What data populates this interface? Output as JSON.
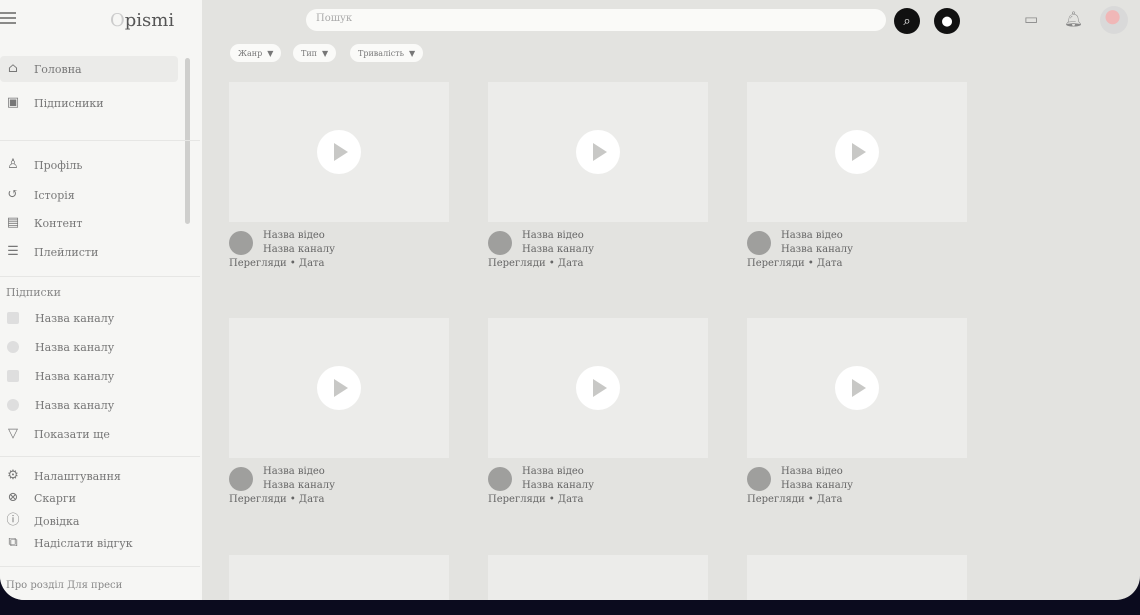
{
  "app": {
    "logo_text": "pismi",
    "logo_mark": "O"
  },
  "search": {
    "placeholder": "Пошук"
  },
  "sidebar": {
    "main_items": [
      {
        "label": "Головна",
        "icon": "home-icon"
      },
      {
        "label": "Підписники",
        "icon": "subscriptions-icon"
      }
    ],
    "profile_items": [
      {
        "label": "Профіль",
        "icon": "user-icon"
      },
      {
        "label": "Історія",
        "icon": "history-icon"
      },
      {
        "label": "Контент",
        "icon": "content-icon"
      },
      {
        "label": "Плейлисти",
        "icon": "playlist-icon"
      }
    ],
    "subscriptions_title": "Підписки",
    "subscriptions": [
      {
        "label": "Назва каналу"
      },
      {
        "label": "Назва каналу"
      },
      {
        "label": "Назва каналу"
      },
      {
        "label": "Назва каналу"
      }
    ],
    "show_more": "Показати ще",
    "settings_items": [
      {
        "label": "Налаштування",
        "icon": "settings-icon"
      },
      {
        "label": "Скарги",
        "icon": "flag-icon"
      },
      {
        "label": "Довідка",
        "icon": "help-icon"
      },
      {
        "label": "Надіслати відгук",
        "icon": "feedback-icon"
      }
    ],
    "footer": "Про розділ  Для преси"
  },
  "filters": [
    {
      "label": "Жанр"
    },
    {
      "label": "Тип"
    },
    {
      "label": "Тривалість"
    }
  ],
  "videos": [
    {
      "title": "Назва відео",
      "channel": "Назва каналу",
      "meta": "Перегляди • Дата"
    },
    {
      "title": "Назва відео",
      "channel": "Назва каналу",
      "meta": "Перегляди • Дата"
    },
    {
      "title": "Назва відео",
      "channel": "Назва каналу",
      "meta": "Перегляди • Дата"
    },
    {
      "title": "Назва відео",
      "channel": "Назва каналу",
      "meta": "Перегляди • Дата"
    },
    {
      "title": "Назва відео",
      "channel": "Назва каналу",
      "meta": "Перегляди • Дата"
    },
    {
      "title": "Назва відео",
      "channel": "Назва каналу",
      "meta": "Перегляди • Дата"
    }
  ],
  "colors": {
    "background": "#e3e3e0",
    "sidebar": "#f6f6f4",
    "frame": "#0b0b1e"
  }
}
